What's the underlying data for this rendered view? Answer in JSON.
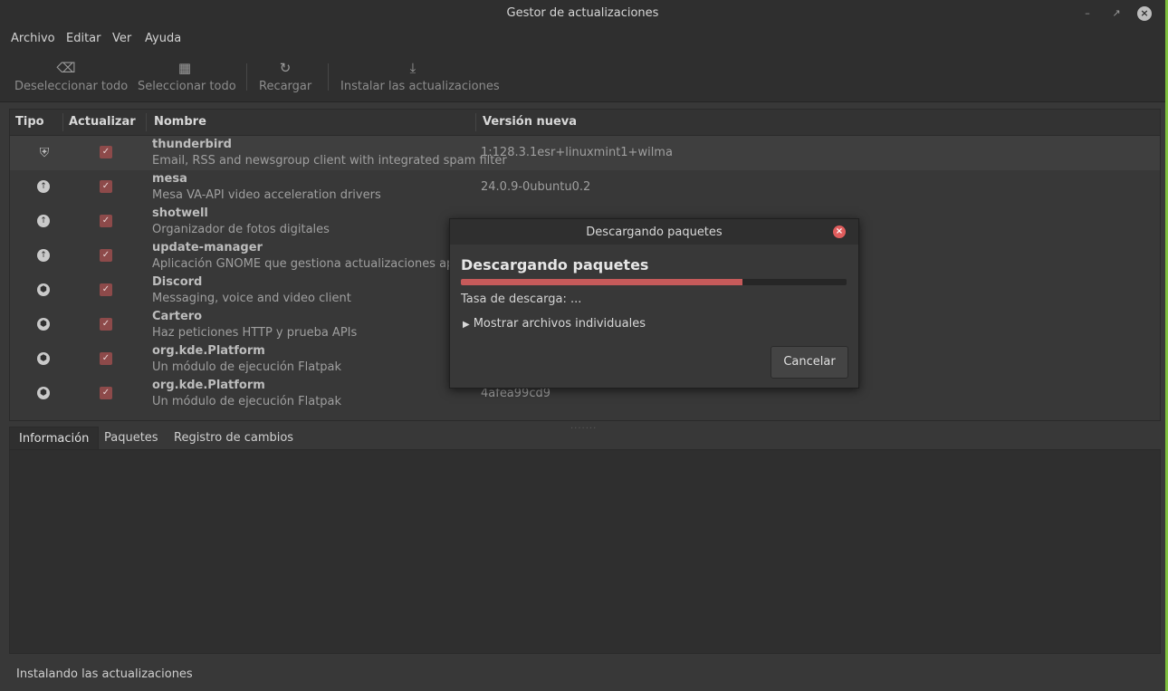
{
  "window": {
    "title": "Gestor de actualizaciones"
  },
  "menu": [
    "Archivo",
    "Editar",
    "Ver",
    "Ayuda"
  ],
  "toolbar": {
    "deselect_all": "Deseleccionar todo",
    "select_all": "Seleccionar todo",
    "reload": "Recargar",
    "install": "Instalar las actualizaciones"
  },
  "table": {
    "columns": [
      "Tipo",
      "Actualizar",
      "Nombre",
      "Versión nueva"
    ],
    "rows": [
      {
        "type_icon": "shield-icon",
        "checked": true,
        "name": "thunderbird",
        "desc": "Email, RSS and newsgroup client with integrated spam filter",
        "version": "1:128.3.1esr+linuxmint1+wilma"
      },
      {
        "type_icon": "arrow-up-icon",
        "checked": true,
        "name": "mesa",
        "desc": "Mesa VA-API video acceleration drivers",
        "version": "24.0.9-0ubuntu0.2"
      },
      {
        "type_icon": "arrow-up-icon",
        "checked": true,
        "name": "shotwell",
        "desc": "Organizador de fotos digitales",
        "version": ""
      },
      {
        "type_icon": "arrow-up-icon",
        "checked": true,
        "name": "update-manager",
        "desc": "Aplicación GNOME que gestiona actualizaciones apt",
        "version": ""
      },
      {
        "type_icon": "package-icon",
        "checked": true,
        "name": "Discord",
        "desc": "Messaging, voice and video client",
        "version": ""
      },
      {
        "type_icon": "package-icon",
        "checked": true,
        "name": "Cartero",
        "desc": "Haz peticiones HTTP y prueba APIs",
        "version": ""
      },
      {
        "type_icon": "package-icon",
        "checked": true,
        "name": "org.kde.Platform",
        "desc": "Un módulo de ejecución Flatpak",
        "version": ""
      },
      {
        "type_icon": "package-icon",
        "checked": true,
        "name": "org.kde.Platform",
        "desc": "Un módulo de ejecución Flatpak",
        "version": "4afea99cd9"
      }
    ]
  },
  "tabs": [
    "Información",
    "Paquetes",
    "Registro de cambios"
  ],
  "status": "Instalando las actualizaciones",
  "dialog": {
    "title": "Descargando paquetes",
    "heading": "Descargando paquetes",
    "progress": 0.73,
    "rate_label": "Tasa de descarga: ...",
    "expander_label": "Mostrar archivos individuales",
    "cancel_label": "Cancelar",
    "accent_color": "#c65a5a"
  }
}
